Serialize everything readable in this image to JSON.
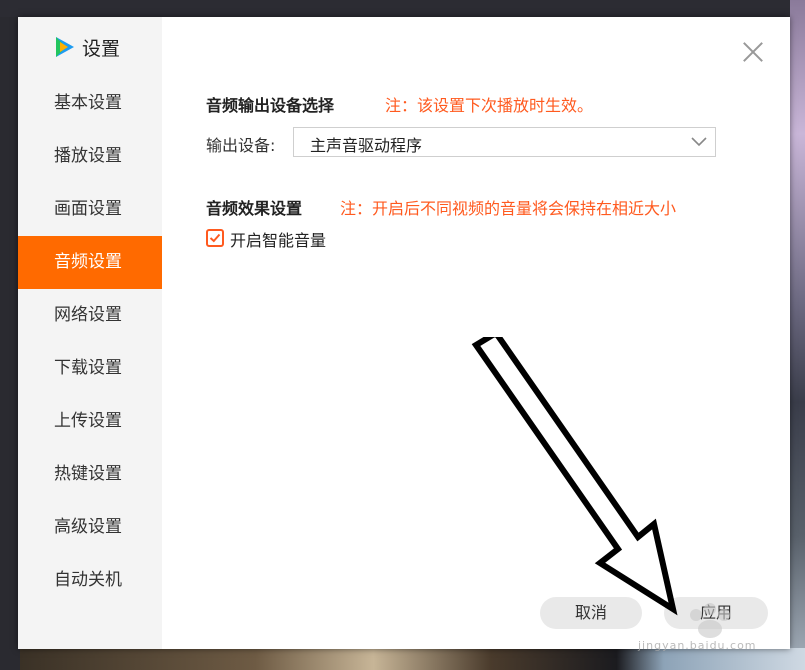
{
  "dialog": {
    "title": "设置",
    "close_icon": "close-icon"
  },
  "sidebar": {
    "items": [
      {
        "label": "基本设置"
      },
      {
        "label": "播放设置"
      },
      {
        "label": "画面设置"
      },
      {
        "label": "音频设置",
        "active": true
      },
      {
        "label": "网络设置"
      },
      {
        "label": "下载设置"
      },
      {
        "label": "上传设置"
      },
      {
        "label": "热键设置"
      },
      {
        "label": "高级设置"
      },
      {
        "label": "自动关机"
      }
    ]
  },
  "audio_output": {
    "title": "音频输出设备选择",
    "note": "注：该设置下次播放时生效。",
    "device_label": "输出设备:",
    "device_value": "主声音驱动程序"
  },
  "audio_effect": {
    "title": "音频效果设置",
    "note": "注：开启后不同视频的音量将会保持在相近大小",
    "smart_volume_label": "开启智能音量",
    "smart_volume_checked": true
  },
  "footer": {
    "cancel_label": "取消",
    "apply_label": "应用"
  },
  "watermark": {
    "url": "jingyan.baidu.com"
  },
  "colors": {
    "accent": "#ff6a00",
    "note": "#ff5a1f"
  }
}
